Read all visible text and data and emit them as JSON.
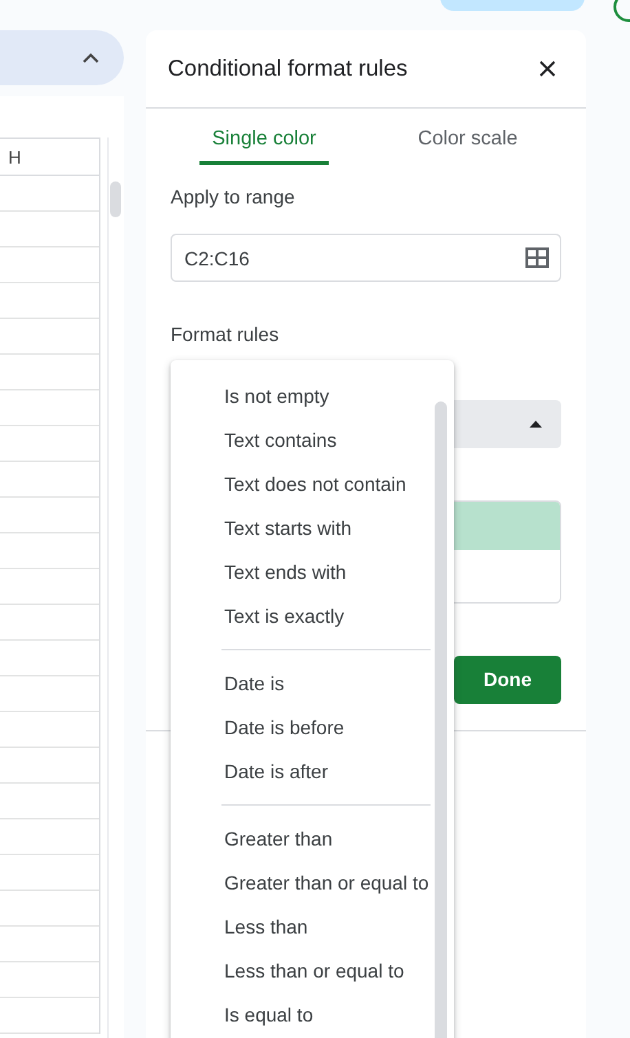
{
  "sheet": {
    "column_header": "H"
  },
  "panel": {
    "title": "Conditional format rules",
    "tabs": [
      {
        "label": "Single color",
        "selected": true
      },
      {
        "label": "Color scale",
        "selected": false
      }
    ],
    "apply_to_range": {
      "label": "Apply to range",
      "value": "C2:C16"
    },
    "format_rules": {
      "label": "Format rules"
    },
    "done_button": "Done"
  },
  "condition_menu": {
    "groups": [
      [
        "Is not empty",
        "Text contains",
        "Text does not contain",
        "Text starts with",
        "Text ends with",
        "Text is exactly"
      ],
      [
        "Date is",
        "Date is before",
        "Date is after"
      ],
      [
        "Greater than",
        "Greater than or equal to",
        "Less than",
        "Less than or equal to",
        "Is equal to"
      ]
    ]
  }
}
